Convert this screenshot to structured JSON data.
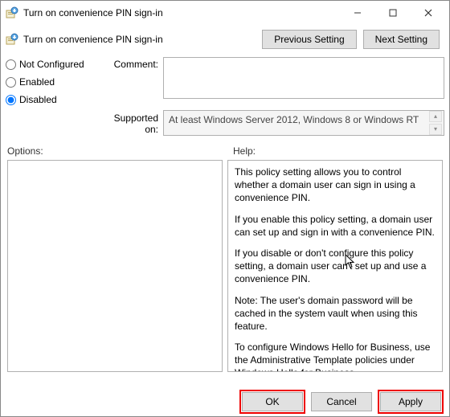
{
  "window": {
    "title": "Turn on convenience PIN sign-in",
    "minimize": "—",
    "maximize": "▢",
    "close": "✕"
  },
  "header": {
    "policy_title": "Turn on convenience PIN sign-in",
    "prev_btn": "Previous Setting",
    "next_btn": "Next Setting"
  },
  "state": {
    "not_configured_label": "Not Configured",
    "enabled_label": "Enabled",
    "disabled_label": "Disabled",
    "selected": "disabled"
  },
  "comment_label": "Comment:",
  "comment_value": "",
  "supported_label": "Supported on:",
  "supported_value": "At least Windows Server 2012, Windows 8 or Windows RT",
  "panes": {
    "options_label": "Options:",
    "help_label": "Help:",
    "help_paragraphs": [
      "This policy setting allows you to control whether a domain user can sign in using a convenience PIN.",
      "If you enable this policy setting, a domain user can set up and sign in with a convenience PIN.",
      "If you disable or don't configure this policy setting, a domain user can't set up and use a convenience PIN.",
      "Note: The user's domain password will be cached in the system vault when using this feature.",
      "To configure Windows Hello for Business, use the Administrative Template policies under Windows Hello for Business."
    ]
  },
  "footer": {
    "ok": "OK",
    "cancel": "Cancel",
    "apply": "Apply"
  }
}
